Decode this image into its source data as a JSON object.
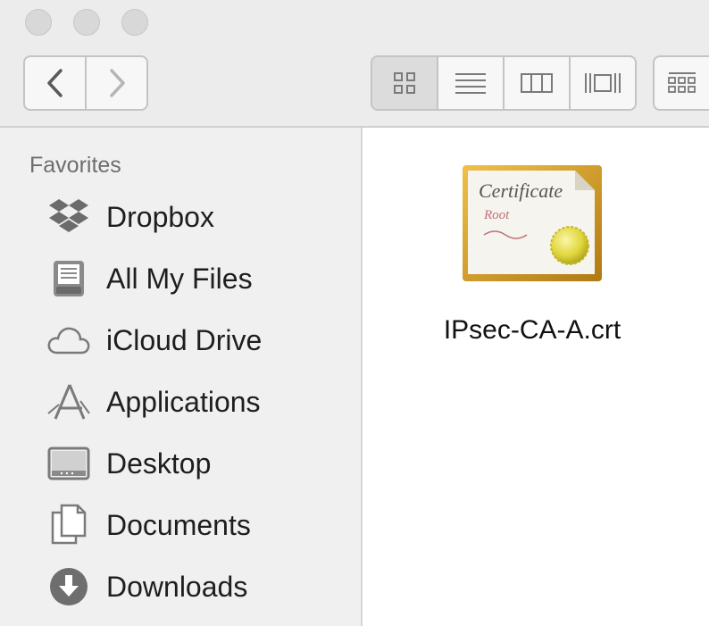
{
  "toolbar": {
    "nav": {
      "back_icon": "chevron-left-icon",
      "forward_icon": "chevron-right-icon"
    },
    "view_modes": [
      "icon-view",
      "list-view",
      "column-view",
      "cover-flow-view"
    ],
    "active_view": "icon-view",
    "arrange_icon": "arrange-grid-icon"
  },
  "sidebar": {
    "heading": "Favorites",
    "items": [
      {
        "label": "Dropbox",
        "icon": "dropbox-icon"
      },
      {
        "label": "All My Files",
        "icon": "all-my-files-icon"
      },
      {
        "label": "iCloud Drive",
        "icon": "cloud-icon"
      },
      {
        "label": "Applications",
        "icon": "applications-icon"
      },
      {
        "label": "Desktop",
        "icon": "desktop-icon"
      },
      {
        "label": "Documents",
        "icon": "documents-icon"
      },
      {
        "label": "Downloads",
        "icon": "downloads-icon"
      }
    ]
  },
  "content": {
    "files": [
      {
        "name": "IPsec-CA-A.crt",
        "icon": "certificate-icon",
        "icon_text_primary": "Certificate",
        "icon_text_secondary": "Root"
      }
    ]
  },
  "colors": {
    "toolbar_bg": "#ececec",
    "sidebar_bg": "#f0f0f0",
    "content_bg": "#ffffff",
    "certificate_gold": "#d9a21b",
    "seal_yellow": "#e6e04a"
  }
}
